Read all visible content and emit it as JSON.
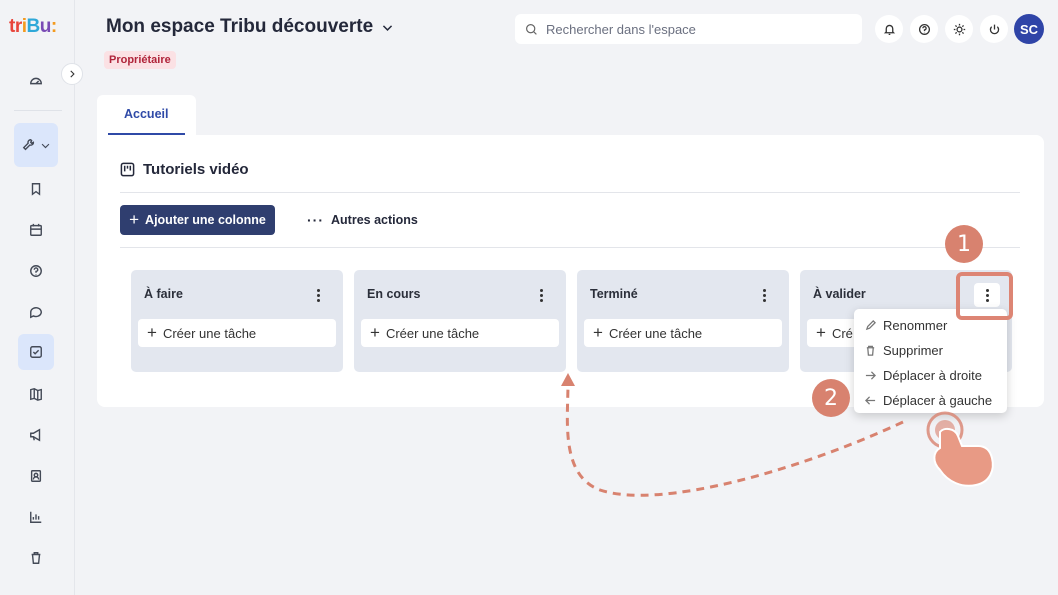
{
  "brand": {
    "logo_text_parts": [
      "tr",
      "i",
      "B",
      "u",
      ":"
    ]
  },
  "sidebar": {
    "items": [
      {
        "icon": "dashboard-icon"
      },
      {
        "icon": "tools-icon"
      },
      {
        "icon": "bookmark-icon"
      },
      {
        "icon": "calendar-icon"
      },
      {
        "icon": "help-icon"
      },
      {
        "icon": "chat-icon"
      },
      {
        "icon": "tasks-icon",
        "active": true
      },
      {
        "icon": "map-icon"
      },
      {
        "icon": "megaphone-icon"
      },
      {
        "icon": "contacts-icon"
      },
      {
        "icon": "chart-icon"
      },
      {
        "icon": "trash-icon"
      }
    ]
  },
  "header": {
    "space_title": "Mon espace Tribu découverte",
    "role_badge": "Propriétaire",
    "search_placeholder": "Rechercher dans l'espace",
    "avatar_initials": "SC"
  },
  "tabs": [
    {
      "label": "Accueil",
      "active": true
    }
  ],
  "board": {
    "title": "Tutoriels vidéo",
    "add_column_label": "Ajouter une colonne",
    "more_actions_label": "Autres actions",
    "columns": [
      {
        "title": "À faire",
        "create_task_label": "Créer une tâche"
      },
      {
        "title": "En cours",
        "create_task_label": "Créer une tâche"
      },
      {
        "title": "Terminé",
        "create_task_label": "Créer une tâche"
      },
      {
        "title": "À valider",
        "create_task_label": "Cré"
      }
    ],
    "column_menu": {
      "items": [
        {
          "label": "Renommer",
          "icon": "pencil-icon"
        },
        {
          "label": "Supprimer",
          "icon": "trash-icon"
        },
        {
          "label": "Déplacer à droite",
          "icon": "arrow-right-icon"
        },
        {
          "label": "Déplacer à gauche",
          "icon": "arrow-left-icon"
        }
      ]
    }
  },
  "annotations": {
    "step1": "1",
    "step2": "2",
    "color": "#d8826f"
  }
}
